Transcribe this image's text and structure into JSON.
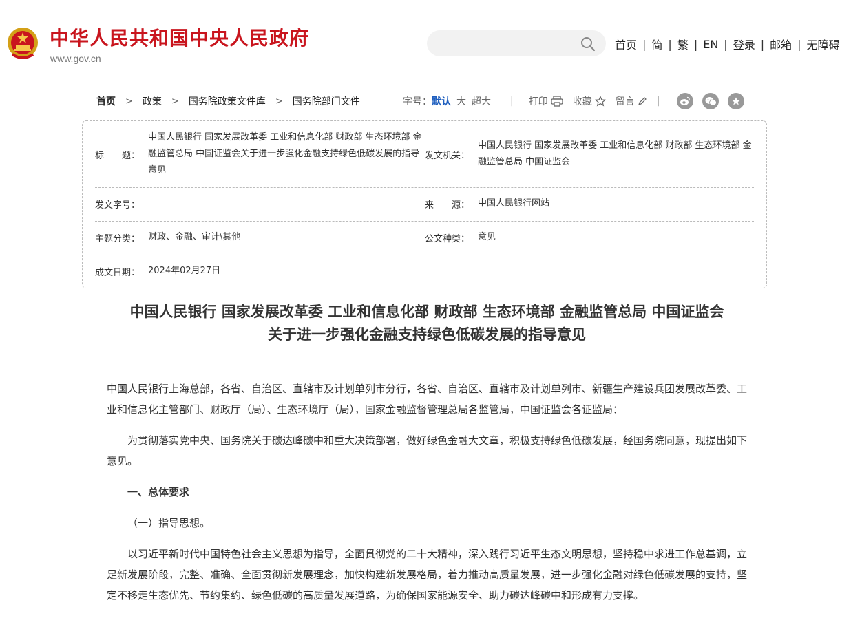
{
  "header": {
    "site_title": "中华人民共和国中央人民政府",
    "site_url": "www.gov.cn",
    "search_placeholder": "",
    "nav": [
      "首页",
      "简",
      "繁",
      "EN",
      "登录",
      "邮箱",
      "无障碍"
    ],
    "nav_separator": "|"
  },
  "breadcrumb": [
    "首页",
    "政策",
    "国务院政策文件库",
    "国务院部门文件"
  ],
  "tools": {
    "font_size_label": "字号：",
    "font_sizes": [
      "默认",
      "大",
      "超大"
    ],
    "separator": "|",
    "print": "打印",
    "favorite": "收藏",
    "comment": "留言"
  },
  "meta": {
    "title_label": "标　　题：",
    "title_value": "中国人民银行 国家发展改革委 工业和信息化部 财政部 生态环境部 金融监管总局 中国证监会关于进一步强化金融支持绿色低碳发展的指导意见",
    "issuer_label": "发文机关：",
    "issuer_value": "中国人民银行 国家发展改革委 工业和信息化部 财政部 生态环境部 金融监管总局 中国证监会",
    "doc_no_label": "发文字号：",
    "doc_no_value": "",
    "source_label": "来　　源：",
    "source_value": "中国人民银行网站",
    "topic_label": "主题分类：",
    "topic_value": "财政、金融、审计\\其他",
    "type_label": "公文种类：",
    "type_value": "意见",
    "date_label": "成文日期：",
    "date_value": "2024年02月27日"
  },
  "document": {
    "heading_line1": "中国人民银行 国家发展改革委 工业和信息化部 财政部 生态环境部 金融监管总局 中国证监会",
    "heading_line2": "关于进一步强化金融支持绿色低碳发展的指导意见",
    "recipients": "中国人民银行上海总部，各省、自治区、直辖市及计划单列市分行，各省、自治区、直辖市及计划单列市、新疆生产建设兵团发展改革委、工业和信息化主管部门、财政厅（局）、生态环境厅（局），国家金融监督管理总局各监管局，中国证监会各证监局：",
    "intro": "为贯彻落实党中央、国务院关于碳达峰碳中和重大决策部署，做好绿色金融大文章，积极支持绿色低碳发展，经国务院同意，现提出如下意见。",
    "section1": "一、总体要求",
    "subsection1": "（一）指导思想。",
    "para1": "以习近平新时代中国特色社会主义思想为指导，全面贯彻党的二十大精神，深入践行习近平生态文明思想，坚持稳中求进工作总基调，立足新发展阶段，完整、准确、全面贯彻新发展理念，加快构建新发展格局，着力推动高质量发展，进一步强化金融对绿色低碳发展的支持，坚定不移走生态优先、节约集约、绿色低碳的高质量发展道路，为确保国家能源安全、助力碳达峰碳中和形成有力支撑。"
  },
  "colors": {
    "brand_red": "#c9151e",
    "link_blue": "#1f5fbf",
    "header_line": "#1f4e8c"
  }
}
